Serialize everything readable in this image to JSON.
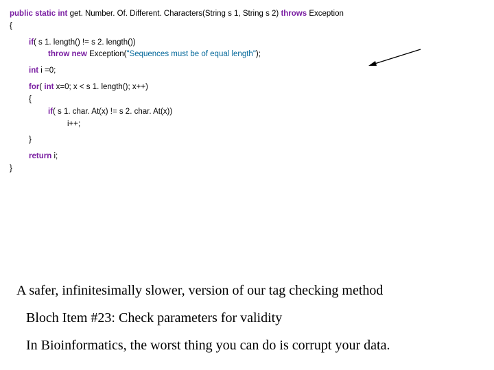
{
  "code": {
    "sig_public": "public",
    "sig_static": "static",
    "sig_int": "int",
    "sig_method": "get. Number. Of. Different. Characters(String s 1, String s 2)",
    "sig_throws": "throws",
    "sig_exc": "Exception",
    "brace_open": "{",
    "if_kw": "if",
    "if_cond": "( s 1. length() != s 2. length())",
    "throw_kw1": "throw",
    "throw_kw2": "new",
    "throw_expr": "Exception(",
    "throw_str": "\"Sequences must be of equal length\"",
    "throw_end": ");",
    "int_kw": "int",
    "int_decl": "i =0;",
    "for_kw": "for",
    "for_open": "(",
    "for_int": "int",
    "for_rest": "x=0; x < s 1. length(); x++)",
    "for_brace_open": "{",
    "inner_if_kw": "if",
    "inner_if_cond": "( s 1. char. At(x) != s 2. char. At(x))",
    "inc": "i++;",
    "for_brace_close": "}",
    "return_kw": "return",
    "return_val": "i;",
    "brace_close": "}"
  },
  "commentary": {
    "p1": "A safer, infinitesimally slower, version of our tag checking method",
    "p2": "Bloch Item #23: Check parameters for validity",
    "p3": "In Bioinformatics, the worst thing you can do is corrupt your data."
  }
}
